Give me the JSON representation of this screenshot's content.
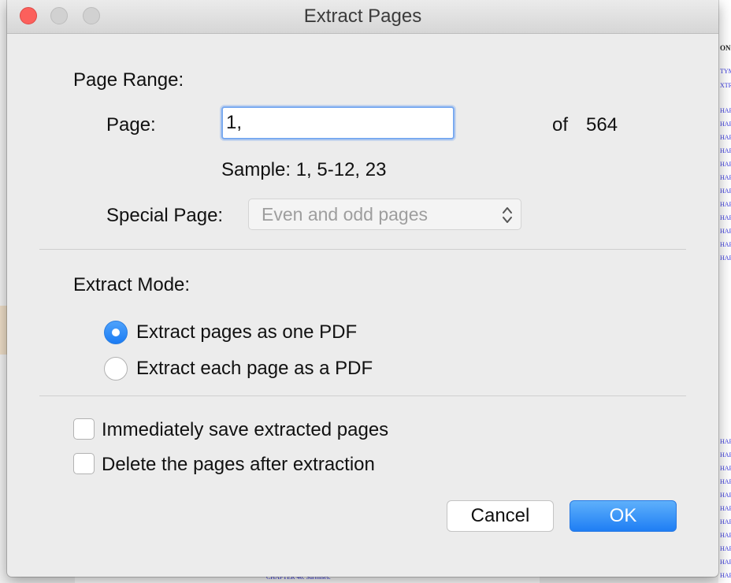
{
  "dialog": {
    "title": "Extract Pages"
  },
  "page_range": {
    "section_label": "Page Range:",
    "page_label": "Page:",
    "page_value": "1,",
    "of_label": "of",
    "total_pages": "564",
    "sample_text": "Sample: 1, 5-12, 23",
    "special_label": "Special Page:",
    "special_selected": "Even and odd pages"
  },
  "extract_mode": {
    "section_label": "Extract Mode:",
    "options": [
      {
        "label": "Extract pages as one PDF",
        "selected": true
      },
      {
        "label": "Extract each page as a PDF",
        "selected": false
      }
    ]
  },
  "options": [
    {
      "label": "Immediately save extracted pages",
      "checked": false
    },
    {
      "label": "Delete the pages after extraction",
      "checked": false
    }
  ],
  "buttons": {
    "cancel": "Cancel",
    "ok": "OK"
  },
  "background": {
    "right_header": "ON",
    "right_lines": [
      "TYM",
      "XTR",
      "HAP",
      "HAP",
      "HAP",
      "HAP",
      "HAP",
      "HAP",
      "HAP",
      "HAP",
      "HAP",
      "HAP",
      "HAP",
      "HAP",
      "HAP",
      "HAP",
      "HAP",
      "HAP",
      "HAP",
      "HAP",
      "HAP",
      "HAP",
      "HAP",
      "HAP",
      "HAP",
      "HAP",
      "HAP",
      "CHAP"
    ],
    "bottom_line": "CHAPTER 46. Surmises."
  },
  "colors": {
    "accent": "#1f7ef4",
    "close": "#fc605c",
    "link": "#3a3adf"
  }
}
